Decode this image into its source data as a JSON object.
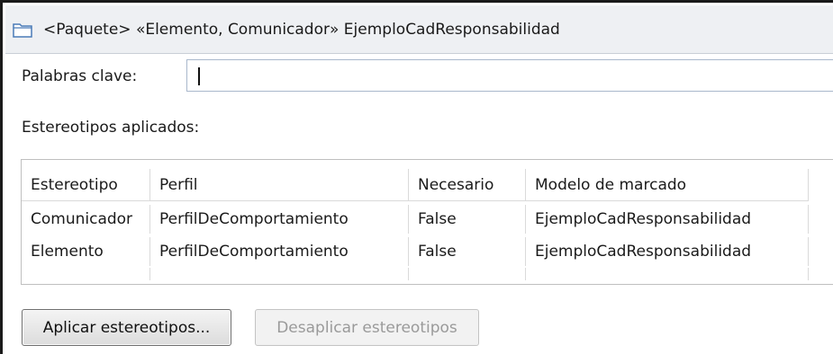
{
  "header": {
    "icon": "folder-icon",
    "title": "<Paquete> «Elemento, Comunicador» EjemploCadResponsabilidad"
  },
  "keywords": {
    "label": "Palabras clave:",
    "value": ""
  },
  "stereotypes": {
    "label": "Estereotipos aplicados:",
    "columns": [
      "Estereotipo",
      "Perfil",
      "Necesario",
      "Modelo de marcado"
    ],
    "rows": [
      [
        "Comunicador",
        "PerfilDeComportamiento",
        "False",
        "EjemploCadResponsabilidad"
      ],
      [
        "Elemento",
        "PerfilDeComportamiento",
        "False",
        "EjemploCadResponsabilidad"
      ]
    ]
  },
  "buttons": {
    "apply_label": "Aplicar estereotipos...",
    "remove_label": "Desaplicar estereotipos"
  }
}
